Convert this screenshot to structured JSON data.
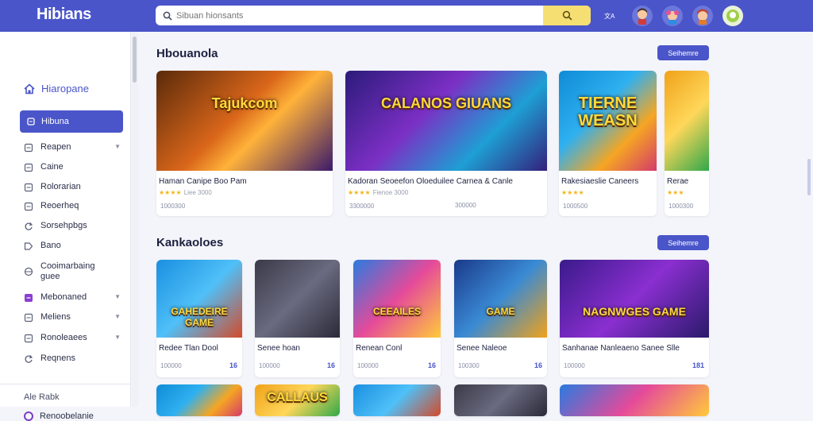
{
  "app": {
    "logo": "Hibians"
  },
  "search": {
    "placeholder": "Sibuan hionsants"
  },
  "sidebar": {
    "home_label": "Hiaropane",
    "active_label": "Hibuna",
    "items": [
      {
        "label": "Reapen",
        "icon": "page-icon",
        "chevron": true
      },
      {
        "label": "Caine",
        "icon": "page-icon",
        "chevron": false
      },
      {
        "label": "Rolorarian",
        "icon": "page-icon",
        "chevron": false
      },
      {
        "label": "Reoerheq",
        "icon": "page-icon",
        "chevron": false
      },
      {
        "label": "Sorsehpbgs",
        "icon": "refresh-icon",
        "chevron": false
      },
      {
        "label": "Bano",
        "icon": "tag-icon",
        "chevron": false
      },
      {
        "label": "Cooimarbaing\nguee",
        "icon": "globe-icon",
        "chevron": false
      },
      {
        "label": "Mebonaned",
        "icon": "purple-icon",
        "chevron": true
      },
      {
        "label": "Meliens",
        "icon": "page-icon",
        "chevron": true
      },
      {
        "label": "Ronoleaees",
        "icon": "page-icon",
        "chevron": true
      },
      {
        "label": "Reqnens",
        "icon": "refresh-icon",
        "chevron": false
      }
    ],
    "footer_heading": "Ale Rabk",
    "footer_item": "Renoobelanie"
  },
  "sections": [
    {
      "title": "Hbouanola",
      "see_all": "Seihemre",
      "cards": [
        {
          "art": "Tajukcom",
          "title": "Haman Canipe Boo Pam",
          "stars": "★★★★",
          "rating": "Liee 3000",
          "meta": "1000300",
          "count": ""
        },
        {
          "art": "CALANOS GIUANS",
          "title": "Kadoran Seoeefon Oloeduilee Carnea & Canle",
          "stars": "★★★★",
          "rating": "Fienoe 3000",
          "meta": "3300000",
          "count": "300000"
        },
        {
          "art": "TIERNE WEASN",
          "title": "Rakesiaeslie Caneers",
          "stars": "★★★★",
          "rating": "",
          "meta": "1000500",
          "count": ""
        },
        {
          "art": "",
          "title": "Rerae",
          "stars": "★★★",
          "rating": "",
          "meta": "1000300",
          "count": ""
        }
      ]
    },
    {
      "title": "Kankaoloes",
      "see_all": "Seihemre",
      "cards": [
        {
          "art": "GAHEDEIRE GAME",
          "title": "Redee Tlan Dool",
          "meta": "100000",
          "count": "16"
        },
        {
          "art": "",
          "title": "Senee hoan",
          "meta": "100000",
          "count": "16"
        },
        {
          "art": "CEEAILES",
          "title": "Renean Conl",
          "meta": "100000",
          "count": "16"
        },
        {
          "art": "GAME",
          "title": "Senee Naleoe",
          "meta": "100300",
          "count": "16"
        },
        {
          "art": "NAGNWGES GAME",
          "title": "Sanhanae Nanleaeno Sanee Slle",
          "meta": "100000",
          "count": "181"
        }
      ]
    },
    {
      "partial_art": [
        "",
        "CALLAUS",
        "",
        "",
        ""
      ]
    }
  ],
  "colors": {
    "accent": "#4a55c9",
    "search_button": "#f5df73",
    "star": "#f3b51b"
  }
}
